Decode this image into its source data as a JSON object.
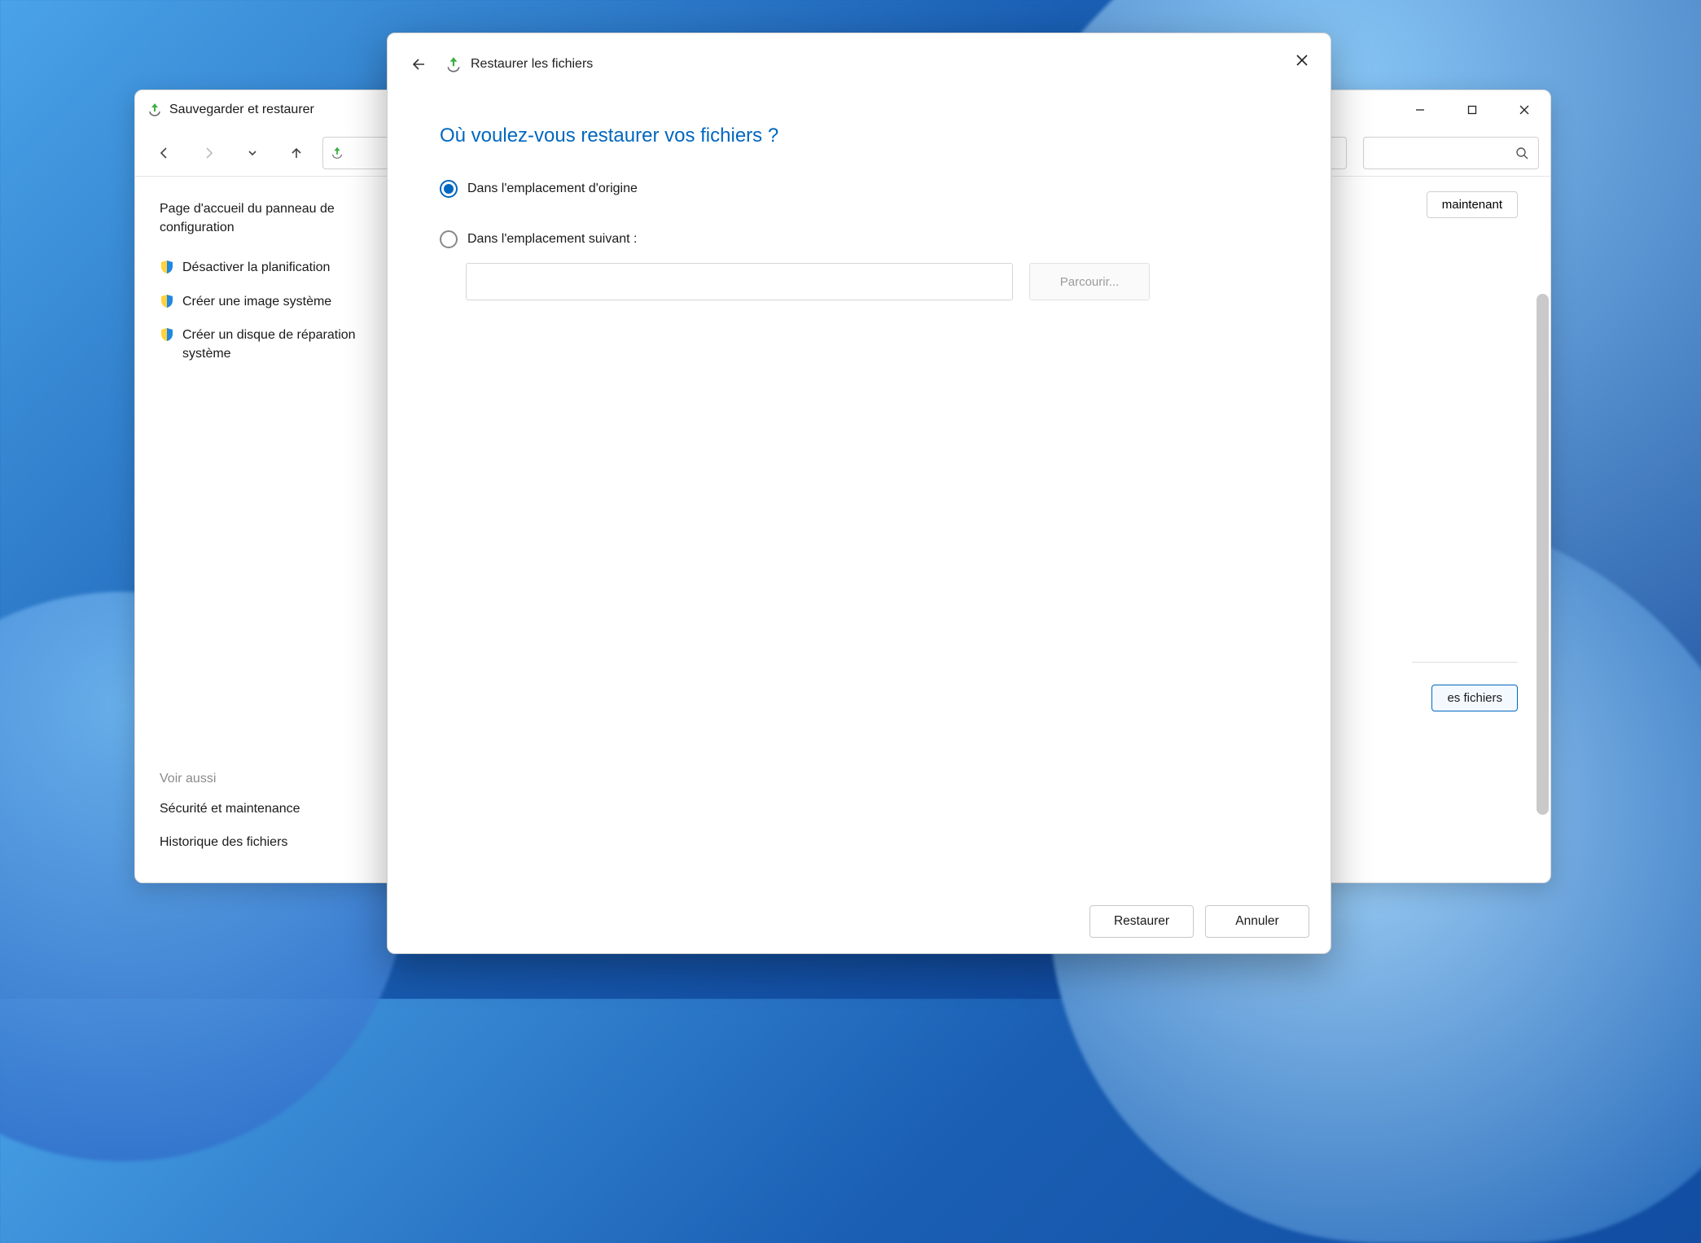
{
  "background_window": {
    "title": "Sauvegarder et restaurer",
    "toolbar": {
      "search_placeholder": ""
    },
    "sidebar": {
      "home_link": "Page d'accueil du panneau de configuration",
      "items": [
        "Désactiver la planification",
        "Créer une image système",
        "Créer un disque de réparation système"
      ],
      "see_also_heading": "Voir aussi",
      "see_also": [
        "Sécurité et maintenance",
        "Historique des fichiers"
      ]
    },
    "content_peek": {
      "button_top": "maintenant",
      "button_bottom": "es fichiers"
    }
  },
  "dialog": {
    "title": "Restaurer les fichiers",
    "heading": "Où voulez-vous restaurer vos fichiers ?",
    "radio_original": "Dans l'emplacement d'origine",
    "radio_custom": "Dans l'emplacement suivant :",
    "browse_label": "Parcourir...",
    "path_value": "",
    "restore_label": "Restaurer",
    "cancel_label": "Annuler"
  }
}
